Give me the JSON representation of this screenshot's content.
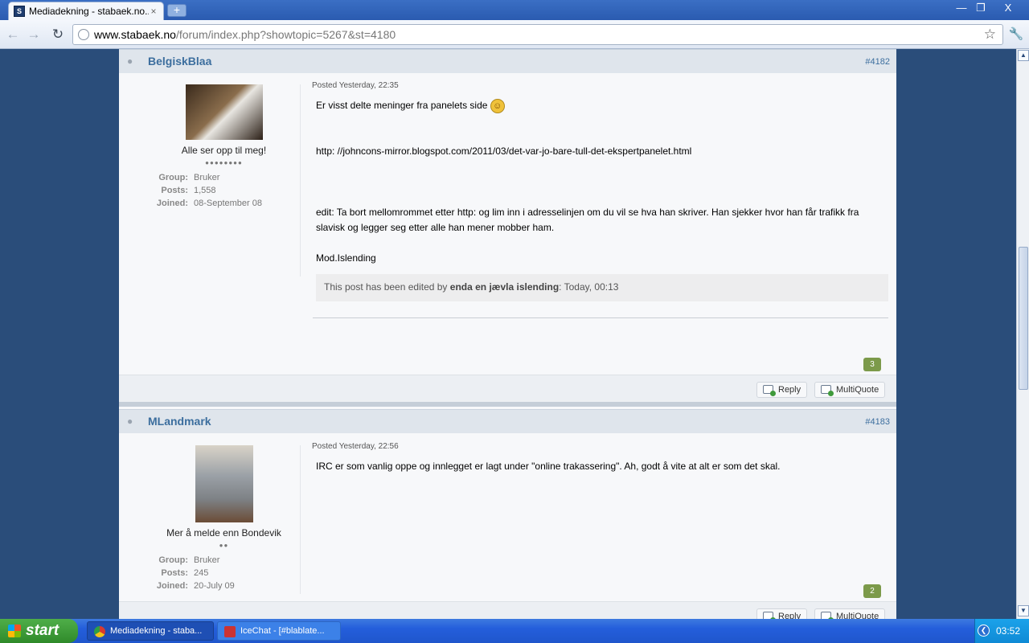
{
  "browser": {
    "tab_title": "Mediadekning - stabaek.no...",
    "tab_close": "×",
    "new_tab": "+",
    "url_host": "www.stabaek.no",
    "url_path": "/forum/index.php?showtopic=5267&st=4180",
    "window_controls": {
      "minimize": "—",
      "maximize": "❐",
      "close": "X"
    }
  },
  "icons": {
    "back": "arrow-left",
    "forward": "arrow-right",
    "reload": "reload",
    "globe": "globe",
    "star": "star",
    "wrench": "wrench",
    "offline": "user-offline",
    "reply": "reply-bubble",
    "multiquote": "multiquote-bubble"
  },
  "posts": [
    {
      "author": "BelgiskBlaa",
      "number": "#4182",
      "member_title": "Alle ser opp til meg!",
      "pips": "●●●●●●●●",
      "group_label": "Group:",
      "group": "Bruker",
      "posts_label": "Posts:",
      "posts": "1,558",
      "joined_label": "Joined:",
      "joined": "08-September 08",
      "posted": "Posted Yesterday, 22:35",
      "lines": [
        "Er visst delte meninger fra panelets side",
        "http: //johncons-mirror.blogspot.com/2011/03/det-var-jo-bare-tull-det-ekspertpanelet.html",
        "edit: Ta bort mellomrommet etter http: og lim inn i adresselinjen om du vil se hva han skriver. Han sjekker hvor han får trafikk fra slavisk og legger seg etter alle han mener mobber ham.",
        "Mod.Islending"
      ],
      "edit_prefix": "This post has been edited by ",
      "edit_by": "enda en jævla islending",
      "edit_time": ": Today, 00:13",
      "reputation": "3",
      "reply": "Reply",
      "multiquote": "MultiQuote"
    },
    {
      "author": "MLandmark",
      "number": "#4183",
      "member_title": "Mer å melde enn Bondevik",
      "pips": "●●",
      "group_label": "Group:",
      "group": "Bruker",
      "posts_label": "Posts:",
      "posts": "245",
      "joined_label": "Joined:",
      "joined": "20-July 09",
      "posted": "Posted Yesterday, 22:56",
      "lines": [
        "IRC er som vanlig oppe og innlegget er lagt under \"online trakassering\". Ah, godt å vite at alt er som det skal."
      ],
      "reputation": "2",
      "reply": "Reply",
      "multiquote": "MultiQuote"
    }
  ],
  "taskbar": {
    "start": "start",
    "tasks": [
      "Mediadekning - staba...",
      "IceChat - [#blablate..."
    ],
    "clock": "03:52"
  }
}
